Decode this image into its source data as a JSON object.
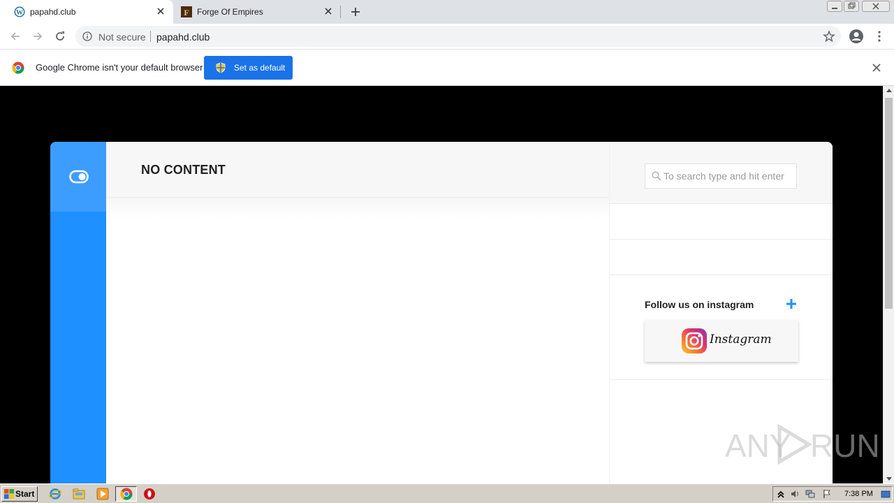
{
  "browser": {
    "tabs": [
      {
        "title": "papahd.club",
        "active": true
      },
      {
        "title": "Forge Of Empires",
        "active": false
      }
    ],
    "omnibox": {
      "security_label": "Not secure",
      "url": "papahd.club"
    },
    "infobar": {
      "message": "Google Chrome isn't your default browser",
      "button_label": "Set as default"
    }
  },
  "page": {
    "main_title": "NO CONTENT",
    "search": {
      "placeholder": "To search type and hit enter",
      "value": ""
    },
    "instagram": {
      "heading": "Follow us on instagram",
      "brand_text": "Instagram"
    },
    "watermark": {
      "left": "ANY",
      "right": "RUN"
    }
  },
  "taskbar": {
    "start_label": "Start",
    "clock": "7:38 PM"
  },
  "colors": {
    "accent_blue": "#1e90ff",
    "button_blue": "#1a73e8"
  }
}
